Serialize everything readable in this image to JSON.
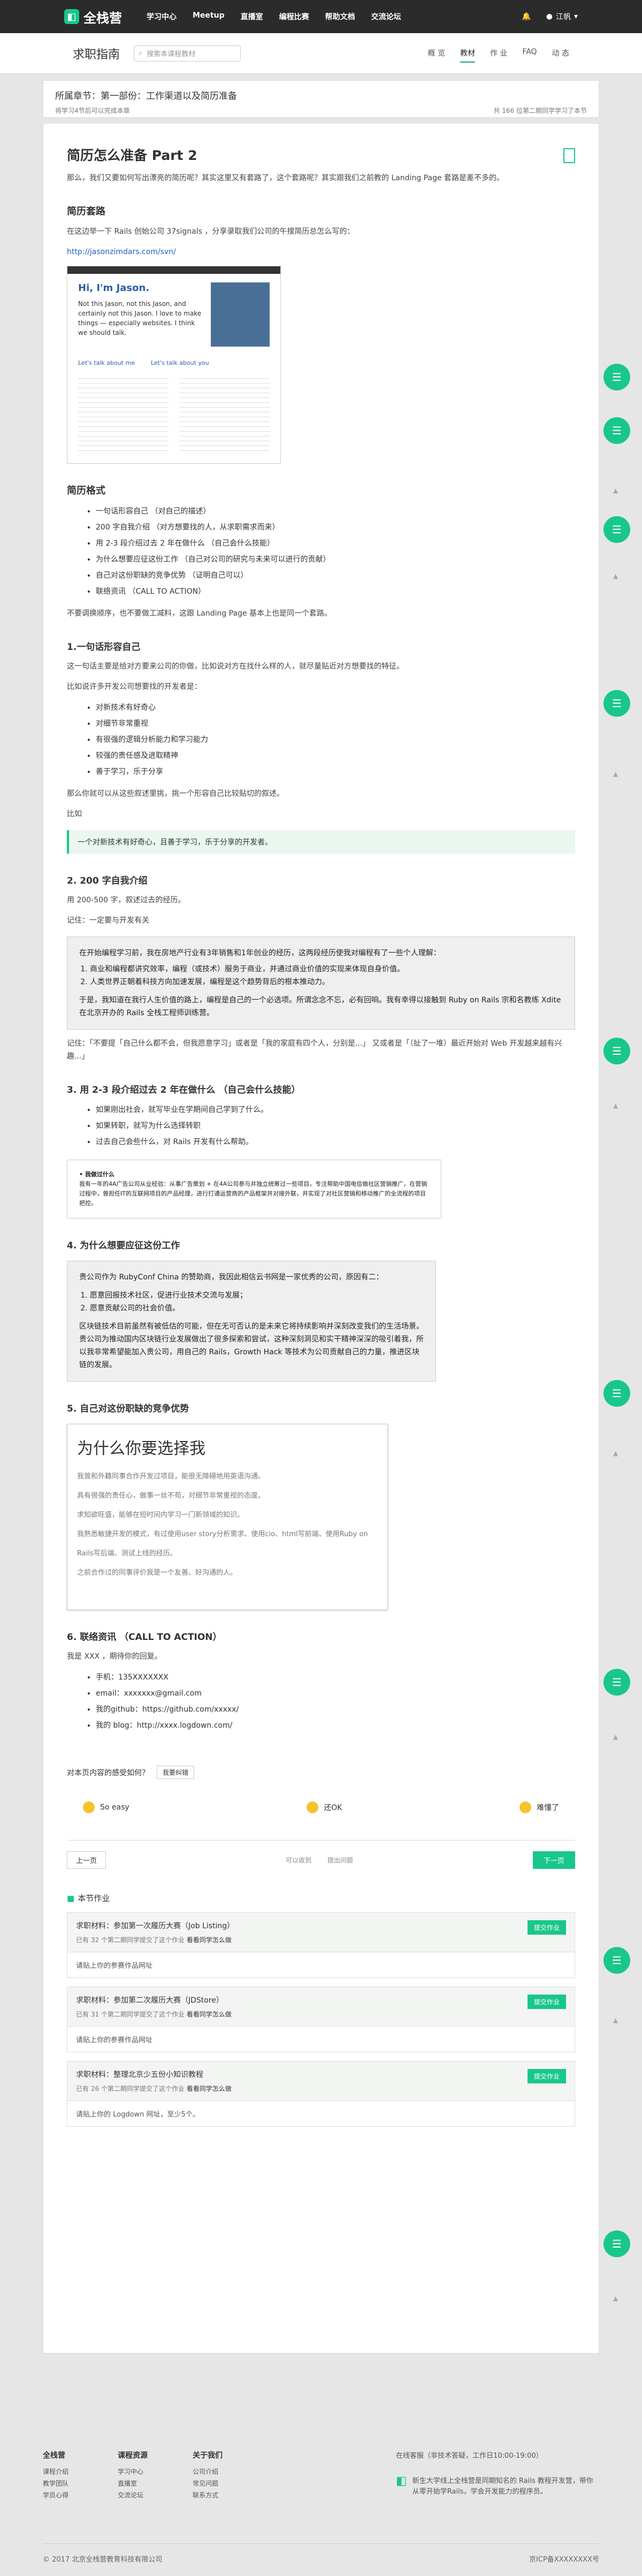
{
  "nav": {
    "brand": "全栈营",
    "items": [
      "学习中心",
      "Meetup",
      "直播室",
      "编程比赛",
      "帮助文档",
      "交流论坛"
    ],
    "user": "江帆"
  },
  "sub": {
    "title": "求职指南",
    "search_placeholder": "搜索本课程教材",
    "tabs": [
      "概 览",
      "教材",
      "作 业",
      "FAQ",
      "动 态"
    ]
  },
  "chapter": {
    "label": "所属章节：第一部份：工作渠道以及简历准备",
    "note": "将学习4节后可以完成本章",
    "progress": "共 166 位第二期同学学习了本节"
  },
  "article": {
    "title": "简历怎么准备 Part 2",
    "intro": "那么，我们又要如何写出漂亮的简历呢？其实这里又有套路了，这个套路呢？其实跟我们之前教的 Landing Page 套路是差不多的。",
    "s1": "简历套路",
    "s1_p": "在这边举一下 Rails 创始公司 37signals ，分享录取我们公司的午搜简历总怎么写的：",
    "s1_link": "http://jasonzimdars.com/svn/",
    "img": {
      "title": "Hi, I'm Jason.",
      "body": "Not this Jason, not this Jason, and certainly not this Jason. I love to make things — especially websites. I think we should talk.",
      "left": "Let's talk about me",
      "right": "Let's talk about you"
    },
    "s2": "简历格式",
    "s2_list": [
      "一句话形容自己 （对自己的描述）",
      "200 字自我介绍 （对方想要找的人，从求职需求而来）",
      "用 2-3 段介绍过去 2 年在做什么 （自己会什么技能）",
      "为什么想要应征这份工作 （自己对公司的研究与未来可以进行的贡献）",
      "自己对这份职缺的竞争优势 （证明自己可以）",
      "联络资讯 （CALL TO ACTION）"
    ],
    "s2_p": "不要调换顺序，也不要做工减料，这跟 Landing Page 基本上也是同一个套路。",
    "s3": "1.一句话形容自己",
    "s3_p1": "这一句话主要是给对方要来公司的你做，比如说对方在找什么样的人，就尽量贴近对方想要找的特征。",
    "s3_p2": "比如说许多开发公司想要找的开发者是：",
    "s3_list": [
      "对新技术有好奇心",
      "对细节非常重视",
      "有很强的逻辑分析能力和学习能力",
      "较强的责任感及进取精神",
      "善于学习，乐于分享"
    ],
    "s3_p3": "那么你就可以从这些叙述里挑，挑一个形容自己比较贴切的叙述。",
    "s3_p4": "比如",
    "s3_quote": "一个对新技术有好奇心，且善于学习，乐于分享的开发者。",
    "s4": "2. 200 字自我介绍",
    "s4_p": "用 200-500 字，叙述过去的经历。",
    "s4_p2": "记住：一定要与开发有关",
    "s4_box_1": "在开始编程学习前，我在房地产行业有3年销售和1年创业的经历，这两段经历使我对编程有了一些个人理解：",
    "s4_box_list": [
      "商业和编程都讲究效率，编程（或技术）服务于商业，并通过商业价值的实现来体现自身价值。",
      "人类世界正朝着科技方向加速发展，编程是这个趋势背后的根本推动力。"
    ],
    "s4_box_2": "于是，我知道在我行人生价值的路上，编程是自己的一个必选项。所谓念念不忘，必有回响。我有幸得以接触到 Ruby on Rails 宗和名教练 Xdite 在北京开办的 Rails 全栈工程师训练营。",
    "s4_after": "记住：「不要提「自己什么都不会，但我愿意学习」或者是「我的家庭有四个人，分别是...」 又或者是「（扯了一堆）最近开始对 Web 开发越来越有兴趣...」",
    "s5": "3. 用 2-3 段介绍过去 2 年在做什么 （自己会什么技能）",
    "s5_list": [
      "如果刚出社会，就写毕业在学期间自己学到了什么。",
      "如果转职，就写为什么选择转职",
      "过去自己会些什么，对 Rails 开发有什么帮助。"
    ],
    "s5_box_title": "• 我做过什么",
    "s5_box": "我有一年的4A广告公司从业经验：从事广告策划 + 在4A公司参与并独立统筹过一些项目，专注帮助中国电信做社区营销推广，在营销过程中，曾担任IT的互联网项目的产品经理，进行打通运营商的产品框架并对接外联，并实现了对社区营销和移动推广的全流程的项目把控。",
    "s6": "4. 为什么想要应征这份工作",
    "s6_box_1": "贵公司作为 RubyConf China 的赞助商，我因此相信云书网是一家优秀的公司，原因有二：",
    "s6_box_list": [
      "愿意回报技术社区，促进行业技术交流与发展；",
      "愿意贡献公司的社会价值。"
    ],
    "s6_box_2": "区块链技术目前虽然有被低估的可能，但在无可否认的是未来它将持续影响并深刻改变我们的生活场景。贵公司为推动国内区块链行业发展做出了很多探索和尝试，这种深刻洞见和实干精神深深的吸引着我，所以我非常希望能加入贵公司，用自己的 Rails，Growth Hack 等技术为公司贡献自己的力量，推进区块链的发展。",
    "s7": "5. 自己对这份职缺的竞争优势",
    "s7_why": "为什么你要选择我",
    "s7_why_list": [
      "我曾和外籍同事合作开发过项目，能很无障碍地用英语沟通。",
      "具有很强的责任心，做事一丝不苟，对细节非常重视的态度。",
      "求知欲旺盛，能够在短时间内学习一门新领域的知识。",
      "我熟悉敏捷开发的模式，有过使用user story分析需求、使用cio、html写前端、使用Ruby on Rails写后端、测试上线的经历。",
      "之前合作过的同事评价我是一个友善、好沟通的人。"
    ],
    "s8": "6. 联络资讯 （CALL TO ACTION）",
    "s8_p": "我是 XXX ，期待你的回复。",
    "s8_list": [
      "手机：135XXXXXXX",
      "email：xxxxxxx@gmail.com",
      "我的github：https://github.com/xxxxx/",
      "我的 blog：http://xxxx.logdown.com/"
    ]
  },
  "feedback": {
    "question": "对本页内容的感受如何？",
    "btn": "我要纠错",
    "opts": [
      "So easy",
      "还OK",
      "难懂了"
    ]
  },
  "pager": {
    "prev": "上一页",
    "mid1": "可以收到",
    "mid2": "提出问题",
    "next": "下一页"
  },
  "homework": {
    "title": "本节作业",
    "items": [
      {
        "name": "求职材料：参加第一次履历大赛（Job Listing）",
        "meta": "已有 32 个第二期同学提交了这个作业",
        "view": "看看同学怎么做",
        "btn": "提交作业",
        "desc": "请贴上你的参赛作品网址"
      },
      {
        "name": "求职材料：参加第二次履历大赛（JDStore）",
        "meta": "已有 31 个第二期同学提交了这个作业",
        "view": "看看同学怎么做",
        "btn": "提交作业",
        "desc": "请贴上你的参赛作品网址"
      },
      {
        "name": "求职材料：整理北京少五份小知识教程",
        "meta": "已有 26 个第二期同学提交了这个作业",
        "view": "看看同学怎么做",
        "btn": "提交作业",
        "desc": "请贴上你的 Logdown 网址，至少5个。"
      }
    ]
  },
  "footer": {
    "cols": [
      {
        "h": "全栈营",
        "items": [
          "课程介绍",
          "教学团队",
          "学员心得"
        ]
      },
      {
        "h": "课程资源",
        "items": [
          "学习中心",
          "直播室",
          "交流论坛"
        ]
      },
      {
        "h": "关于我们",
        "items": [
          "公司介绍",
          "常见问题",
          "联系方式"
        ]
      }
    ],
    "hot": "在线客服（非技术答疑，工作日10:00-19:00）",
    "slogan": "新生大学线上全栈营是同期知名的 Rails 教程开发营，带你从零开始学Rails，学会开发能力的程序员。",
    "copy": "© 2017 北京全栈营教育科技有限公司",
    "icp": "京ICP备XXXXXXXX号"
  }
}
